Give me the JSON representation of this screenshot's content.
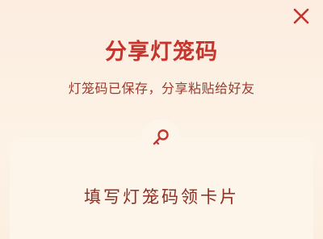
{
  "dialog": {
    "title": "分享灯笼码",
    "subtitle": "灯笼码已保存，分享粘贴给好友",
    "close_icon": "close-icon",
    "key_icon": "key-icon",
    "card_label": "填写灯笼码领卡片"
  },
  "colors": {
    "accent": "#c5352d",
    "text_secondary": "#9b3a2c",
    "background": "#fcefe0"
  }
}
